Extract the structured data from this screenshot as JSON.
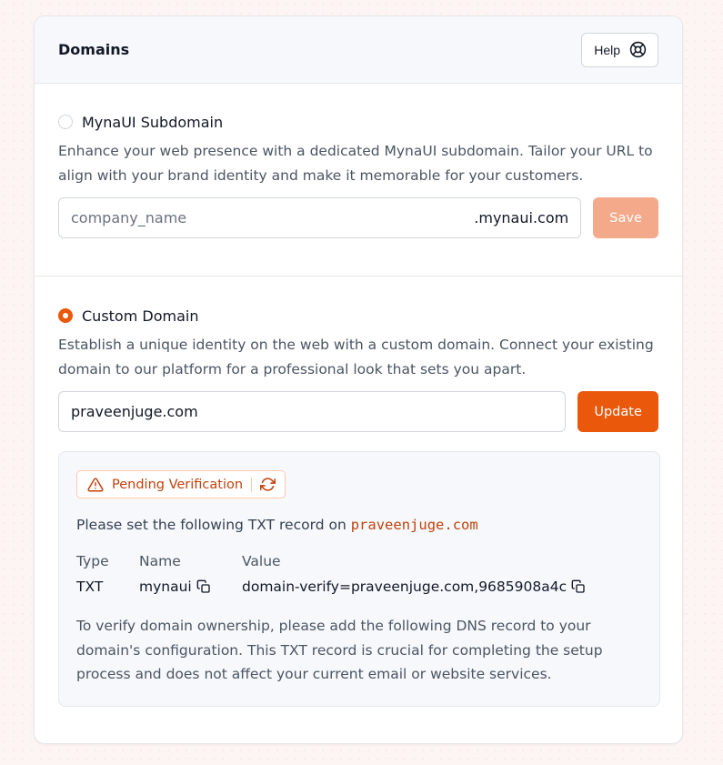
{
  "header": {
    "title": "Domains",
    "help_label": "Help"
  },
  "subdomain": {
    "label": "MynaUI Subdomain",
    "description": "Enhance your web presence with a dedicated MynaUI subdomain. Tailor your URL to align with your brand identity and make it memorable for your customers.",
    "input_placeholder": "company_name",
    "input_value": "",
    "suffix": ".mynaui.com",
    "save_label": "Save",
    "selected": false
  },
  "custom_domain": {
    "label": "Custom Domain",
    "description": "Establish a unique identity on the web with a custom domain. Connect your existing domain to our platform for a professional look that sets you apart.",
    "input_value": "praveenjuge.com",
    "update_label": "Update",
    "selected": true
  },
  "verification": {
    "status": "Pending Verification",
    "instruction_prefix": "Please set the following TXT record on",
    "domain": "praveenjuge.com",
    "columns": {
      "type": "Type",
      "name": "Name",
      "value": "Value"
    },
    "record": {
      "type": "TXT",
      "name": "mynaui",
      "value": "domain-verify=praveenjuge.com,9685908a4c"
    },
    "note": "To verify domain ownership, please add the following DNS record to your domain's configuration. This TXT record is crucial for completing the setup process and does not affect your current email or website services."
  },
  "colors": {
    "accent": "#ea580c",
    "accent_light": "#f4a98a",
    "warning_text": "#c2410c"
  },
  "icons": {
    "help": "lifebuoy-icon",
    "warning": "warning-triangle-icon",
    "refresh": "refresh-icon",
    "copy": "copy-icon"
  }
}
